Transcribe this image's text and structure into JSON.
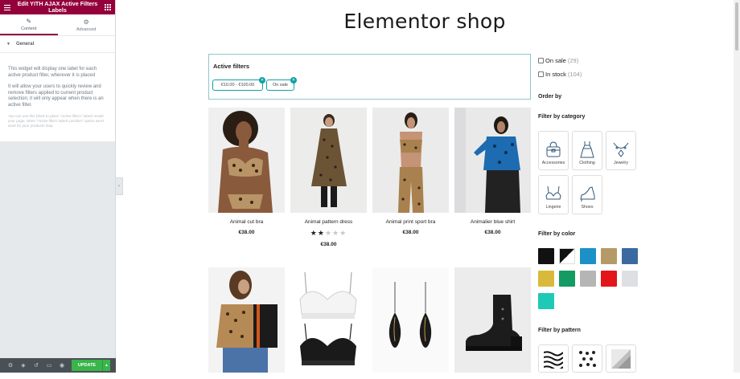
{
  "editor": {
    "title": "Edit YITH AJAX Active Filters Labels",
    "tabs": [
      {
        "label": "Content",
        "icon": "pencil-icon"
      },
      {
        "label": "Advanced",
        "icon": "gear-icon"
      }
    ],
    "section_label": "General",
    "description_1": "This widget will display one label for each active product filter, wherever it is placed",
    "description_2": "It will allow your users to quickly review and remove filters applied to current product selection; it will only appear when there is an active filter.",
    "note": "You can use this block to place \"Active filters\" labels inside your page, when \"Active filters labels position\" option won't work for your products loop.",
    "footer": {
      "update_label": "UPDATE",
      "icons": [
        "gear-icon",
        "layers-icon",
        "history-icon",
        "responsive-icon",
        "eye-icon"
      ]
    },
    "brand_color": "#93003c",
    "update_color": "#39b54a"
  },
  "shop": {
    "title": "Elementor shop",
    "active_filters": {
      "heading": "Active filters",
      "labels": [
        "€10.00 - €100.00",
        "On sale"
      ]
    },
    "products": [
      {
        "name": "Animal cut bra",
        "price": "€38.00"
      },
      {
        "name": "Animal pattern dress",
        "price": "€38.00",
        "rating": 2,
        "max_rating": 5
      },
      {
        "name": "Animal print sport bra",
        "price": "€38.00"
      },
      {
        "name": "Animalier blue shirt",
        "price": "€38.00"
      },
      {
        "name": "",
        "price": ""
      },
      {
        "name": "",
        "price": ""
      },
      {
        "name": "",
        "price": ""
      },
      {
        "name": "",
        "price": ""
      }
    ]
  },
  "filters": {
    "on_sale": {
      "label": "On sale",
      "count": "(29)"
    },
    "in_stock": {
      "label": "In stock",
      "count": "(104)"
    },
    "order_by": "Order by",
    "category": {
      "heading": "Filter by category",
      "items": [
        {
          "label": "Accessories",
          "icon": "bag-icon"
        },
        {
          "label": "Clothing",
          "icon": "dress-icon"
        },
        {
          "label": "Jewelry",
          "icon": "necklace-icon"
        },
        {
          "label": "Lingerie",
          "icon": "bra-icon"
        },
        {
          "label": "Shoes",
          "icon": "heel-icon"
        }
      ]
    },
    "color": {
      "heading": "Filter by color",
      "swatches": [
        "#111111",
        "#111111/#ffffff",
        "#1b91c7",
        "#b59a68",
        "#3b6aa1",
        "#d9b93c",
        "#149a63",
        "#b5b5b5",
        "#e3161b",
        "#dddfe2",
        "#1dc9b7"
      ]
    },
    "pattern": {
      "heading": "Filter by pattern",
      "items": [
        "zebra-pattern",
        "leopard-pattern",
        "geometric-pattern"
      ]
    }
  }
}
